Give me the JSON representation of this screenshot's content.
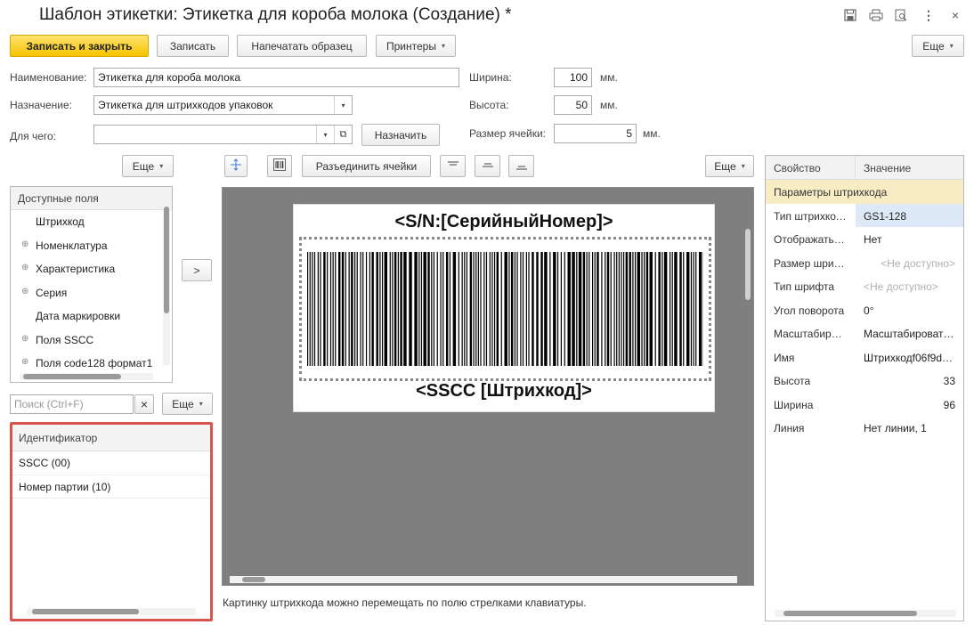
{
  "window": {
    "title": "Шаблон этикетки: Этикетка для короба молока (Создание) *",
    "icons": [
      "save-icon",
      "print-icon",
      "preview-icon",
      "more-vert-icon",
      "close-icon"
    ]
  },
  "toolbar": {
    "save_close": "Записать и закрыть",
    "save": "Записать",
    "print_sample": "Напечатать образец",
    "printers": "Принтеры",
    "more": "Еще"
  },
  "form": {
    "name_label": "Наименование:",
    "name_value": "Этикетка для короба молока",
    "purpose_label": "Назначение:",
    "purpose_value": "Этикетка для штрихкодов упаковок",
    "for_label": "Для чего:",
    "for_value": "",
    "assign_button": "Назначить",
    "width_label": "Ширина:",
    "width_value": "100",
    "width_unit": "мм.",
    "height_label": "Высота:",
    "height_value": "50",
    "height_unit": "мм.",
    "cell_label": "Размер ячейки:",
    "cell_value": "5",
    "cell_unit": "мм."
  },
  "fields_panel": {
    "more": "Еще",
    "header": "Доступные поля",
    "items": [
      {
        "label": "Штрихкод",
        "expandable": false
      },
      {
        "label": "Номенклатура",
        "expandable": true
      },
      {
        "label": "Характеристика",
        "expandable": true
      },
      {
        "label": "Серия",
        "expandable": true
      },
      {
        "label": "Дата маркировки",
        "expandable": false
      },
      {
        "label": "Поля SSCC",
        "expandable": true
      },
      {
        "label": "Поля code128 формат1",
        "expandable": true
      }
    ],
    "add_button": ">"
  },
  "search": {
    "placeholder": "Поиск (Ctrl+F)",
    "clear": "×",
    "more": "Еще"
  },
  "identifiers": {
    "header": "Идентификатор",
    "rows": [
      "SSCC (00)",
      "Номер партии (10)"
    ]
  },
  "designer": {
    "split_cells": "Разъединить ячейки",
    "more": "Еще",
    "sn_text": "<S/N:[СерийныйНомер]>",
    "sscc_text": "<SSCC [Штрихкод]>",
    "hint": "Картинку штрихкода можно перемещать по полю стрелками клавиатуры."
  },
  "properties": {
    "col_property": "Свойство",
    "col_value": "Значение",
    "group": "Параметры штрихкода",
    "rows": [
      {
        "name": "Тип штрихкода",
        "value": "GS1-128"
      },
      {
        "name": "Отображать…",
        "value": "Нет"
      },
      {
        "name": "Размер шри…",
        "value": "<Не доступно>"
      },
      {
        "name": "Тип шрифта",
        "value": "<Не доступно>"
      },
      {
        "name": "Угол поворота",
        "value": "0°"
      },
      {
        "name": "Масштабир…",
        "value": "Масштабироват…"
      },
      {
        "name": "Имя",
        "value": "Штрихкодf06f9d9…"
      },
      {
        "name": "Высота",
        "value": "33"
      },
      {
        "name": "Ширина",
        "value": "96"
      },
      {
        "name": "Линия",
        "value": "Нет линии, 1"
      }
    ]
  }
}
